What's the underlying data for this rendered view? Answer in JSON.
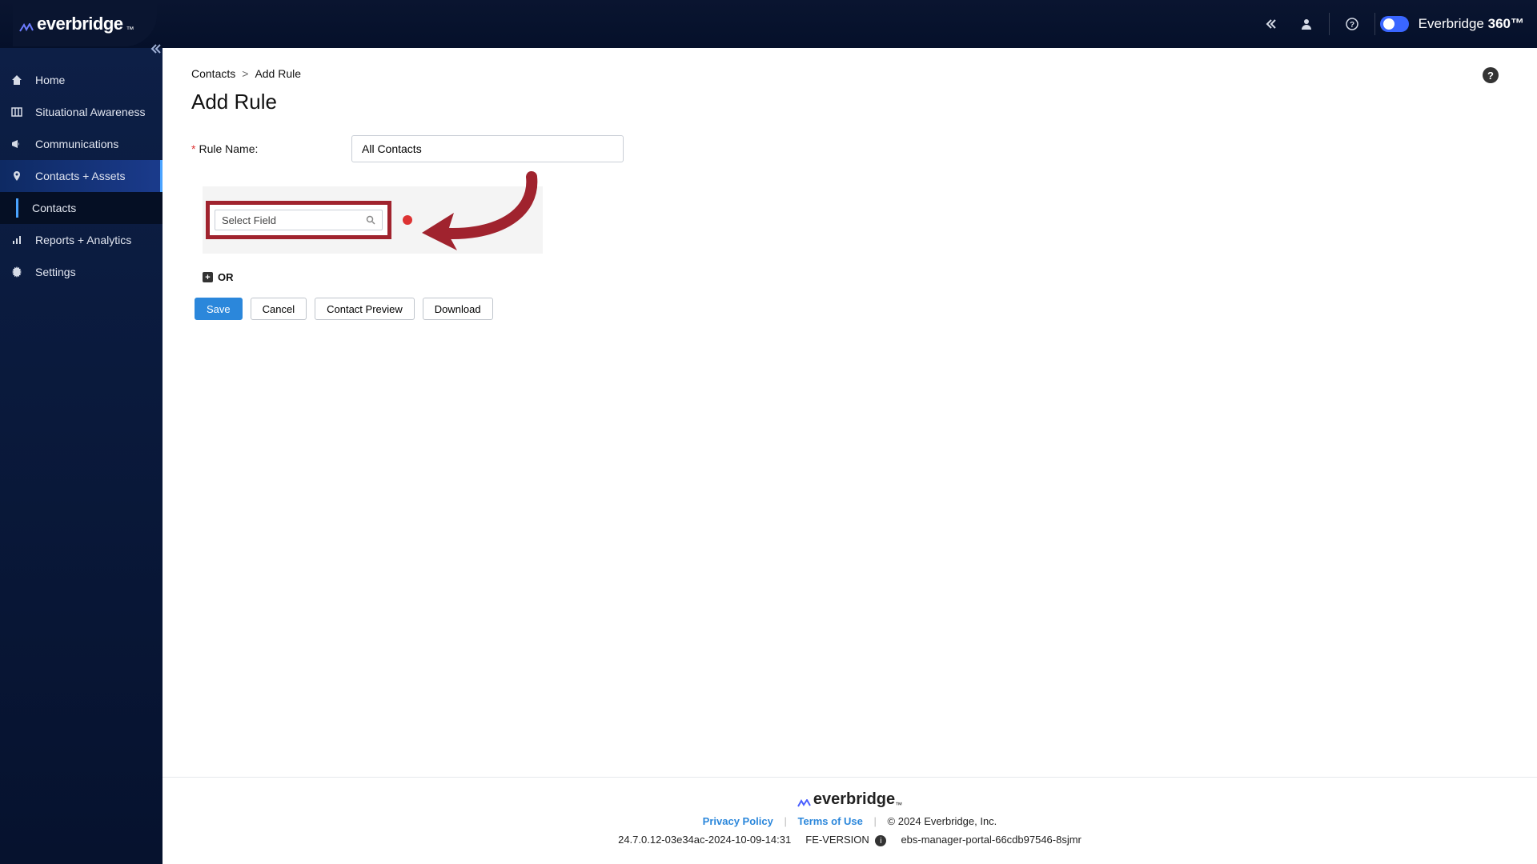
{
  "brand": {
    "name": "everbridge",
    "tm": "™",
    "product": "Everbridge",
    "product_suffix": "360™"
  },
  "sidebar": {
    "items": [
      {
        "label": "Home",
        "icon": "home-icon"
      },
      {
        "label": "Situational Awareness",
        "icon": "map-icon"
      },
      {
        "label": "Communications",
        "icon": "megaphone-icon"
      },
      {
        "label": "Contacts + Assets",
        "icon": "pin-icon"
      },
      {
        "label": "Reports + Analytics",
        "icon": "chart-icon"
      },
      {
        "label": "Settings",
        "icon": "gear-icon"
      }
    ],
    "subitems": [
      {
        "label": "Contacts"
      }
    ]
  },
  "breadcrumb": {
    "root": "Contacts",
    "current": "Add Rule"
  },
  "page": {
    "title": "Add Rule"
  },
  "form": {
    "rule_name_label": "Rule Name:",
    "rule_name_value": "All Contacts",
    "select_field_placeholder": "Select Field",
    "or_label": "OR"
  },
  "buttons": {
    "save": "Save",
    "cancel": "Cancel",
    "preview": "Contact Preview",
    "download": "Download"
  },
  "footer": {
    "privacy": "Privacy Policy",
    "terms": "Terms of Use",
    "copyright": "© 2024 Everbridge, Inc.",
    "build": "24.7.0.12-03e34ac-2024-10-09-14:31",
    "fe_version_label": "FE-VERSION",
    "node": "ebs-manager-portal-66cdb97546-8sjmr"
  }
}
